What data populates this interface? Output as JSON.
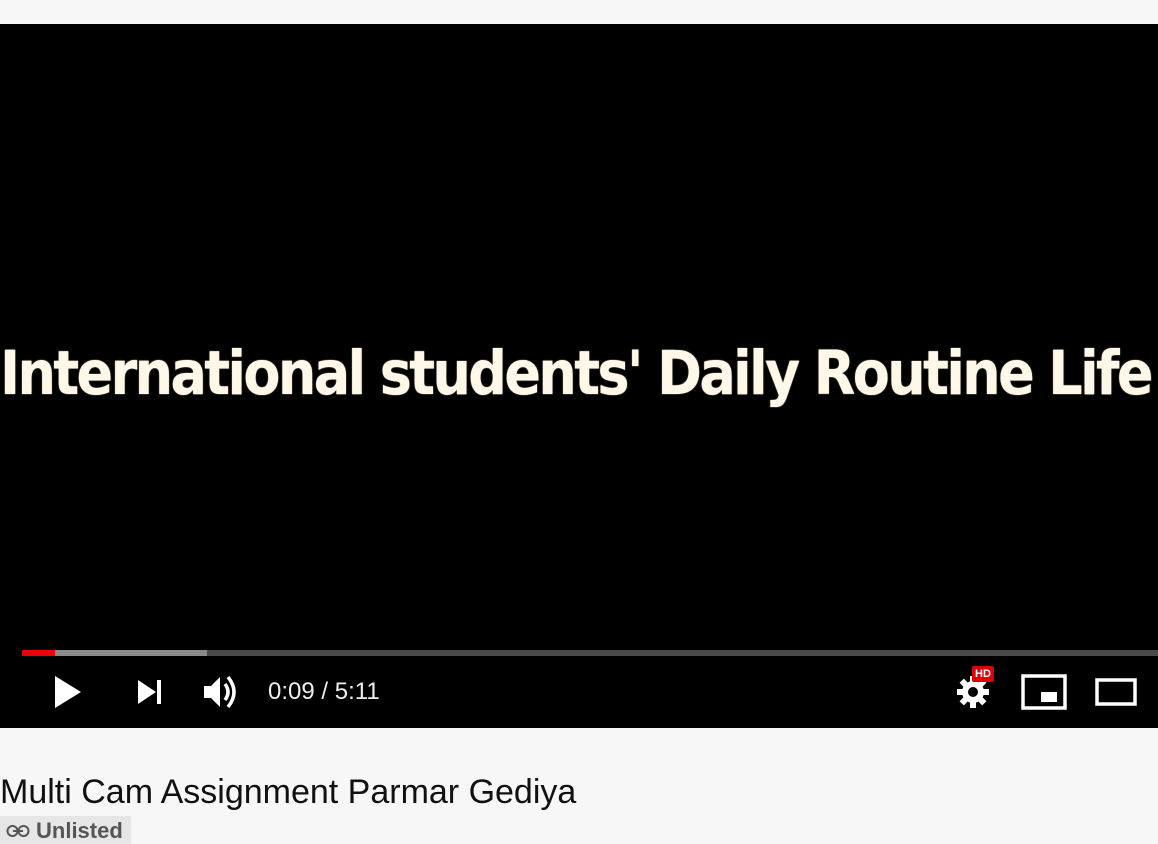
{
  "player": {
    "frame_text": "International students' Daily Routine Life",
    "played_fraction": 0.029,
    "buffered_fraction": 0.163,
    "time_current": "0:09",
    "time_separator": " / ",
    "time_total": "5:11",
    "hd_badge": "HD",
    "colors": {
      "played": "#ee0000",
      "background": "#000000"
    },
    "controls": [
      "play-icon",
      "next-icon",
      "volume-icon",
      "settings-icon",
      "miniplayer-icon",
      "theater-mode-icon"
    ]
  },
  "video": {
    "title": "Multi Cam Assignment Parmar Gediya",
    "visibility": "Unlisted",
    "visibility_icon": "link-icon"
  }
}
